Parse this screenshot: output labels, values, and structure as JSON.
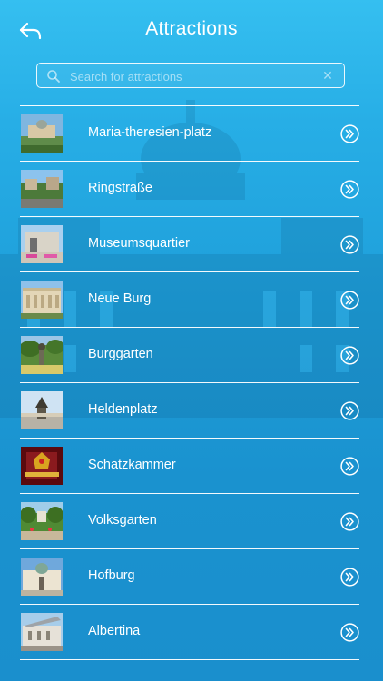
{
  "header": {
    "title": "Attractions",
    "back_icon": "back-arrow-icon"
  },
  "search": {
    "placeholder": "Search for attractions",
    "value": "",
    "clear_icon": "close-icon"
  },
  "attractions": [
    {
      "label": "Maria-theresien-platz",
      "thumb": "maria-theresien-platz-thumbnail"
    },
    {
      "label": "Ringstraße",
      "thumb": "ringstrasse-thumbnail"
    },
    {
      "label": "Museumsquartier",
      "thumb": "museumsquartier-thumbnail"
    },
    {
      "label": "Neue Burg",
      "thumb": "neue-burg-thumbnail"
    },
    {
      "label": "Burggarten",
      "thumb": "burggarten-thumbnail"
    },
    {
      "label": "Heldenplatz",
      "thumb": "heldenplatz-thumbnail"
    },
    {
      "label": "Schatzkammer",
      "thumb": "schatzkammer-thumbnail"
    },
    {
      "label": "Volksgarten",
      "thumb": "volksgarten-thumbnail"
    },
    {
      "label": "Hofburg",
      "thumb": "hofburg-thumbnail"
    },
    {
      "label": "Albertina",
      "thumb": "albertina-thumbnail"
    }
  ],
  "colors": {
    "background_top": "#35bff0",
    "background_bottom": "#1a8fcd",
    "text": "#ffffff"
  }
}
